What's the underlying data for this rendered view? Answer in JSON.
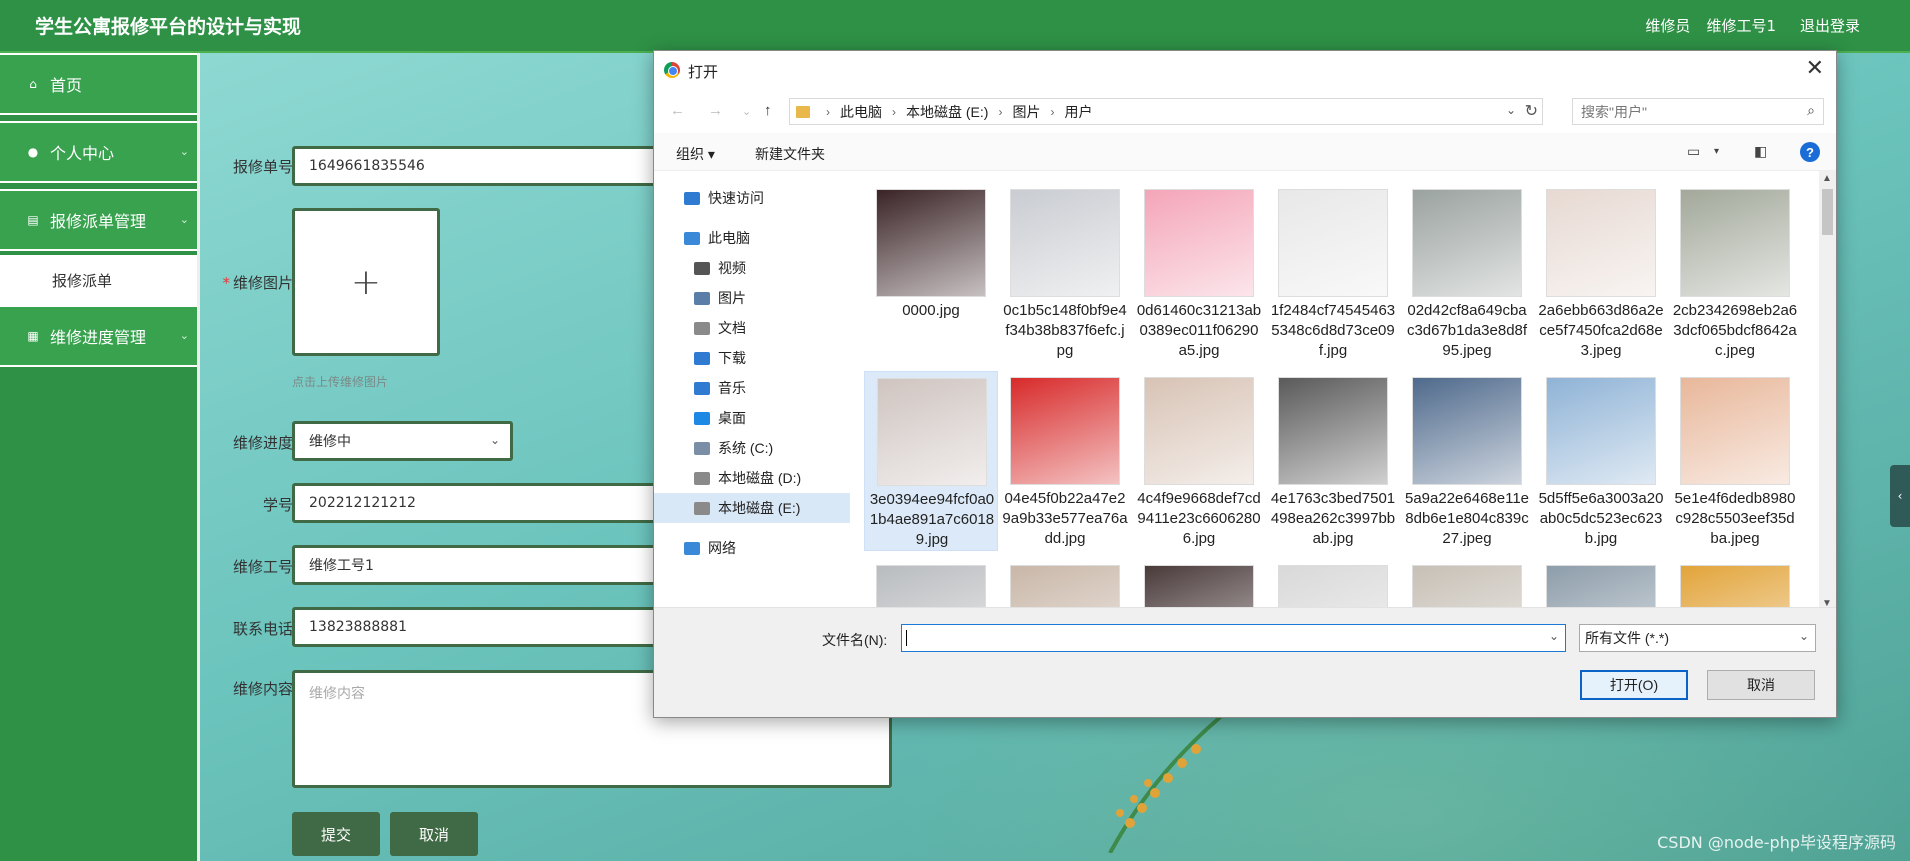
{
  "app": {
    "title": "学生公寓报修平台的设计与实现",
    "user_role": "维修员",
    "user_name": "维修工号1",
    "logout": "退出登录"
  },
  "sidebar": {
    "items": [
      {
        "label": "首页",
        "icon": "home-icon"
      },
      {
        "label": "个人中心",
        "icon": "user-icon"
      },
      {
        "label": "报修派单管理",
        "icon": "list-icon"
      },
      {
        "label": "维修进度管理",
        "icon": "grid-icon"
      }
    ],
    "sub_item": "报修派单"
  },
  "form": {
    "order_no_label": "报修单号",
    "order_no": "1649661835546",
    "image_label": "维修图片",
    "upload_hint": "点击上传维修图片",
    "progress_label": "维修进度",
    "progress_value": "维修中",
    "student_label": "学号",
    "student_value": "202212121212",
    "worker_label": "维修工号",
    "worker_value": "维修工号1",
    "phone_label": "联系电话",
    "phone_value": "13823888881",
    "content_label": "维修内容",
    "content_placeholder": "维修内容",
    "submit": "提交",
    "cancel": "取消"
  },
  "dialog": {
    "title": "打开",
    "breadcrumb": [
      "此电脑",
      "本地磁盘 (E:)",
      "图片",
      "用户"
    ],
    "search_placeholder": "搜索\"用户\"",
    "organize": "组织",
    "new_folder": "新建文件夹",
    "help": "?",
    "nav": [
      {
        "label": "快速访问",
        "color": "#2f7bd1"
      },
      {
        "label": "此电脑",
        "color": "#3a88d8"
      },
      {
        "label": "视频",
        "color": "#555555"
      },
      {
        "label": "图片",
        "color": "#5b7ea8"
      },
      {
        "label": "文档",
        "color": "#8a8a8a"
      },
      {
        "label": "下载",
        "color": "#2f7bd1"
      },
      {
        "label": "音乐",
        "color": "#2f7bd1"
      },
      {
        "label": "桌面",
        "color": "#1e88e5"
      },
      {
        "label": "系统 (C:)",
        "color": "#7a8ea6"
      },
      {
        "label": "本地磁盘 (D:)",
        "color": "#8a8a8a"
      },
      {
        "label": "本地磁盘 (E:)",
        "color": "#8a8a8a",
        "selected": true
      },
      {
        "label": "网络",
        "color": "#3a88d8"
      }
    ],
    "files": [
      {
        "name": "0000.jpg",
        "color": "#3a2326"
      },
      {
        "name": "0c1b5c148f0bf9e4f34b38b837f6efc.jpg",
        "color": "#c9ccd1"
      },
      {
        "name": "0d61460c31213ab0389ec011f06290a5.jpg",
        "color": "#f4a5b8"
      },
      {
        "name": "1f2484cf745454635348c6d8d73ce09f.jpg",
        "color": "#e8e8e8"
      },
      {
        "name": "02d42cf8a649cbac3d67b1da3e8d8f95.jpeg",
        "color": "#9aa29f"
      },
      {
        "name": "2a6ebb663d86a2ece5f7450fca2d68e3.jpeg",
        "color": "#e7d9d2"
      },
      {
        "name": "2cb2342698eb2a63dcf065bdcf8642ac.jpeg",
        "color": "#a2a89a"
      },
      {
        "name": "3e0394ee94fcf0a01b4ae891a7c60189.jpg",
        "color": "#cfc4c0",
        "selected": true
      },
      {
        "name": "04e45f0b22a47e29a9b33e577ea76add.jpg",
        "color": "#d82a2a"
      },
      {
        "name": "4c4f9e9668def7cd9411e23c66062806.jpg",
        "color": "#d8c3b5"
      },
      {
        "name": "4e1763c3bed7501498ea262c3997bbab.jpg",
        "color": "#5a5a5a"
      },
      {
        "name": "5a9a22e6468e11e8db6e1e804c839c27.jpeg",
        "color": "#4f6a8c"
      },
      {
        "name": "5d5ff5e6a3003a20ab0c5dc523ec623b.jpg",
        "color": "#8fb3d6"
      },
      {
        "name": "5e1e4f6dedb8980c928c5503eef35dba.jpeg",
        "color": "#e8b79a"
      },
      {
        "name": "",
        "color": "#b9bcbf"
      },
      {
        "name": "",
        "color": "#c9b7a8"
      },
      {
        "name": "",
        "color": "#4a3a3a"
      },
      {
        "name": "",
        "color": "#d9d9d9"
      },
      {
        "name": "",
        "color": "#c7c0b6"
      },
      {
        "name": "",
        "color": "#8d9daa"
      },
      {
        "name": "",
        "color": "#e2a43a"
      }
    ],
    "filename_label": "文件名(N):",
    "filename_value": "",
    "filetype": "所有文件 (*.*)",
    "open": "打开(O)",
    "cancel": "取消"
  },
  "watermark": "CSDN @node-php毕设程序源码"
}
